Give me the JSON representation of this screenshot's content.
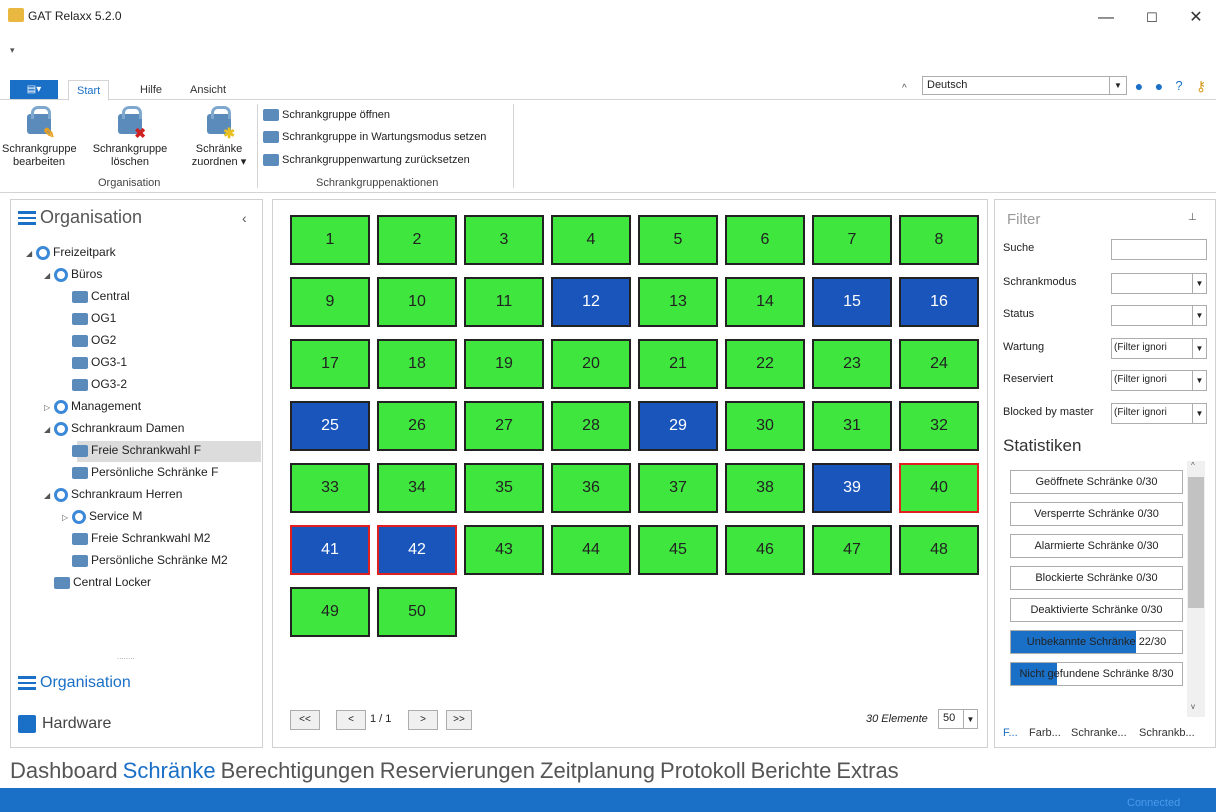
{
  "app": {
    "title": "GAT Relaxx 5.2.0",
    "qat": "▾"
  },
  "window": {
    "minimize": "—",
    "maximize": "☐",
    "close": "✕"
  },
  "ribbon": {
    "tabs": [
      "Start",
      "Hilfe",
      "Ansicht"
    ],
    "file_menu": "▤▾",
    "language": "Deutsch",
    "buttons": [
      {
        "line1": "Schrankgruppe",
        "line2": "bearbeiten"
      },
      {
        "line1": "Schrankgruppe",
        "line2": "löschen"
      },
      {
        "line1": "Schränke",
        "line2": "zuordnen ▾"
      }
    ],
    "group_org": "Organisation",
    "actions": [
      "Schrankgruppe öffnen",
      "Schrankgruppe in Wartungsmodus setzen",
      "Schrankgruppenwartung zurücksetzen"
    ],
    "group_actions": "Schrankgruppenaktionen"
  },
  "left": {
    "header": "Organisation",
    "collapse": "‹",
    "tree": [
      {
        "label": "Freizeitpark",
        "level": 0,
        "toggle": "◢",
        "icon": "org"
      },
      {
        "label": "Büros",
        "level": 1,
        "toggle": "◢",
        "icon": "org"
      },
      {
        "label": "Central",
        "level": 2,
        "toggle": "",
        "icon": "grp"
      },
      {
        "label": "OG1",
        "level": 2,
        "toggle": "",
        "icon": "grp"
      },
      {
        "label": "OG2",
        "level": 2,
        "toggle": "",
        "icon": "grp"
      },
      {
        "label": "OG3-1",
        "level": 2,
        "toggle": "",
        "icon": "grp"
      },
      {
        "label": "OG3-2",
        "level": 2,
        "toggle": "",
        "icon": "grp"
      },
      {
        "label": "Management",
        "level": 1,
        "toggle": "▷",
        "icon": "org"
      },
      {
        "label": "Schrankraum Damen",
        "level": 1,
        "toggle": "◢",
        "icon": "org"
      },
      {
        "label": "Freie Schrankwahl F",
        "level": 2,
        "toggle": "",
        "icon": "grp"
      },
      {
        "label": "Persönliche Schränke F",
        "level": 2,
        "toggle": "",
        "icon": "grp"
      },
      {
        "label": "Schrankraum Herren",
        "level": 1,
        "toggle": "◢",
        "icon": "org"
      },
      {
        "label": "Service M",
        "level": 2,
        "toggle": "▷",
        "icon": "org"
      },
      {
        "label": "Freie Schrankwahl M2",
        "level": 2,
        "toggle": "",
        "icon": "grp"
      },
      {
        "label": "Persönliche Schränke M2",
        "level": 2,
        "toggle": "",
        "icon": "grp"
      },
      {
        "label": "Central Locker",
        "level": 1,
        "toggle": "",
        "icon": "grp"
      }
    ],
    "dots": "........",
    "footer_org": "Organisation",
    "footer_hw": "Hardware"
  },
  "lockers": {
    "blue": [
      12,
      15,
      16,
      25,
      29,
      39,
      41,
      42
    ],
    "alarm": [
      40,
      41,
      42
    ],
    "count": 50
  },
  "pager": {
    "first": "<<",
    "prev": "<",
    "text": "1 / 1",
    "next": ">",
    "last": ">>",
    "elements": "30 Elemente",
    "page_size": "50"
  },
  "filter": {
    "title": "Filter",
    "pin": "📌",
    "fields": [
      {
        "label": "Suche",
        "value": "",
        "dropdown": false
      },
      {
        "label": "Schrankmodus",
        "value": "",
        "dropdown": true
      },
      {
        "label": "Status",
        "value": "",
        "dropdown": true
      },
      {
        "label": "Wartung",
        "value": "(Filter ignori",
        "dropdown": true
      },
      {
        "label": "Reserviert",
        "value": "(Filter ignori",
        "dropdown": true
      },
      {
        "label": "Blocked by master",
        "value": "(Filter ignori",
        "dropdown": true
      }
    ],
    "stats_title": "Statistiken",
    "stats": [
      "Geöffnete Schränke 0/30",
      "Versperrte Schränke 0/30",
      "Alarmierte Schränke 0/30",
      "Blockierte Schränke 0/30",
      "Deaktivierte Schränke 0/30",
      "Unbekannte Schränke 22/30",
      "Nicht gefundene Schränke 8/30"
    ],
    "stats_fill": [
      0,
      0,
      0,
      0,
      0,
      0.73,
      0.27
    ],
    "bottom_tabs": [
      "F...",
      "Farb...",
      "Schranke...",
      "Schrankb..."
    ]
  },
  "nav": [
    "Dashboard",
    "Schränke",
    "Berechtigungen",
    "Reservierungen",
    "Zeitplanung",
    "Protokoll",
    "Berichte",
    "Extras"
  ],
  "status": "Connected",
  "colors": {
    "accent": "#1a6fc6",
    "green": "#3ee63e",
    "blue": "#1a55bb",
    "alarm": "#e02020"
  }
}
